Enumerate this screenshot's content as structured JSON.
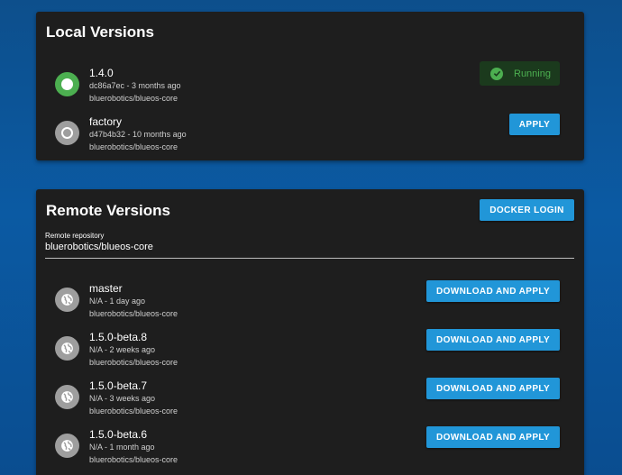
{
  "local": {
    "title": "Local Versions",
    "versions": [
      {
        "name": "1.4.0",
        "meta": "dc86a7ec - 3 months ago",
        "repo": "bluerobotics/blueos-core",
        "status": "Running"
      },
      {
        "name": "factory",
        "meta": "d47b4b32 - 10 months ago",
        "repo": "bluerobotics/blueos-core",
        "action": "APPLY"
      }
    ]
  },
  "remote": {
    "title": "Remote Versions",
    "docker_login_label": "DOCKER LOGIN",
    "repository_label": "Remote repository",
    "repository_value": "bluerobotics/blueos-core",
    "versions": [
      {
        "name": "master",
        "meta": "N/A - 1 day ago",
        "repo": "bluerobotics/blueos-core",
        "action": "DOWNLOAD AND APPLY"
      },
      {
        "name": "1.5.0-beta.8",
        "meta": "N/A - 2 weeks ago",
        "repo": "bluerobotics/blueos-core",
        "action": "DOWNLOAD AND APPLY"
      },
      {
        "name": "1.5.0-beta.7",
        "meta": "N/A - 3 weeks ago",
        "repo": "bluerobotics/blueos-core",
        "action": "DOWNLOAD AND APPLY"
      },
      {
        "name": "1.5.0-beta.6",
        "meta": "N/A - 1 month ago",
        "repo": "bluerobotics/blueos-core",
        "action": "DOWNLOAD AND APPLY"
      }
    ]
  },
  "colors": {
    "accent": "#2196d8",
    "running": "#4caf50",
    "card": "#1e1e1e"
  },
  "icons": {
    "running": "radio-checked-icon",
    "idle": "radio-unchecked-icon",
    "remote": "globe-icon",
    "status": "check-circle-icon"
  }
}
